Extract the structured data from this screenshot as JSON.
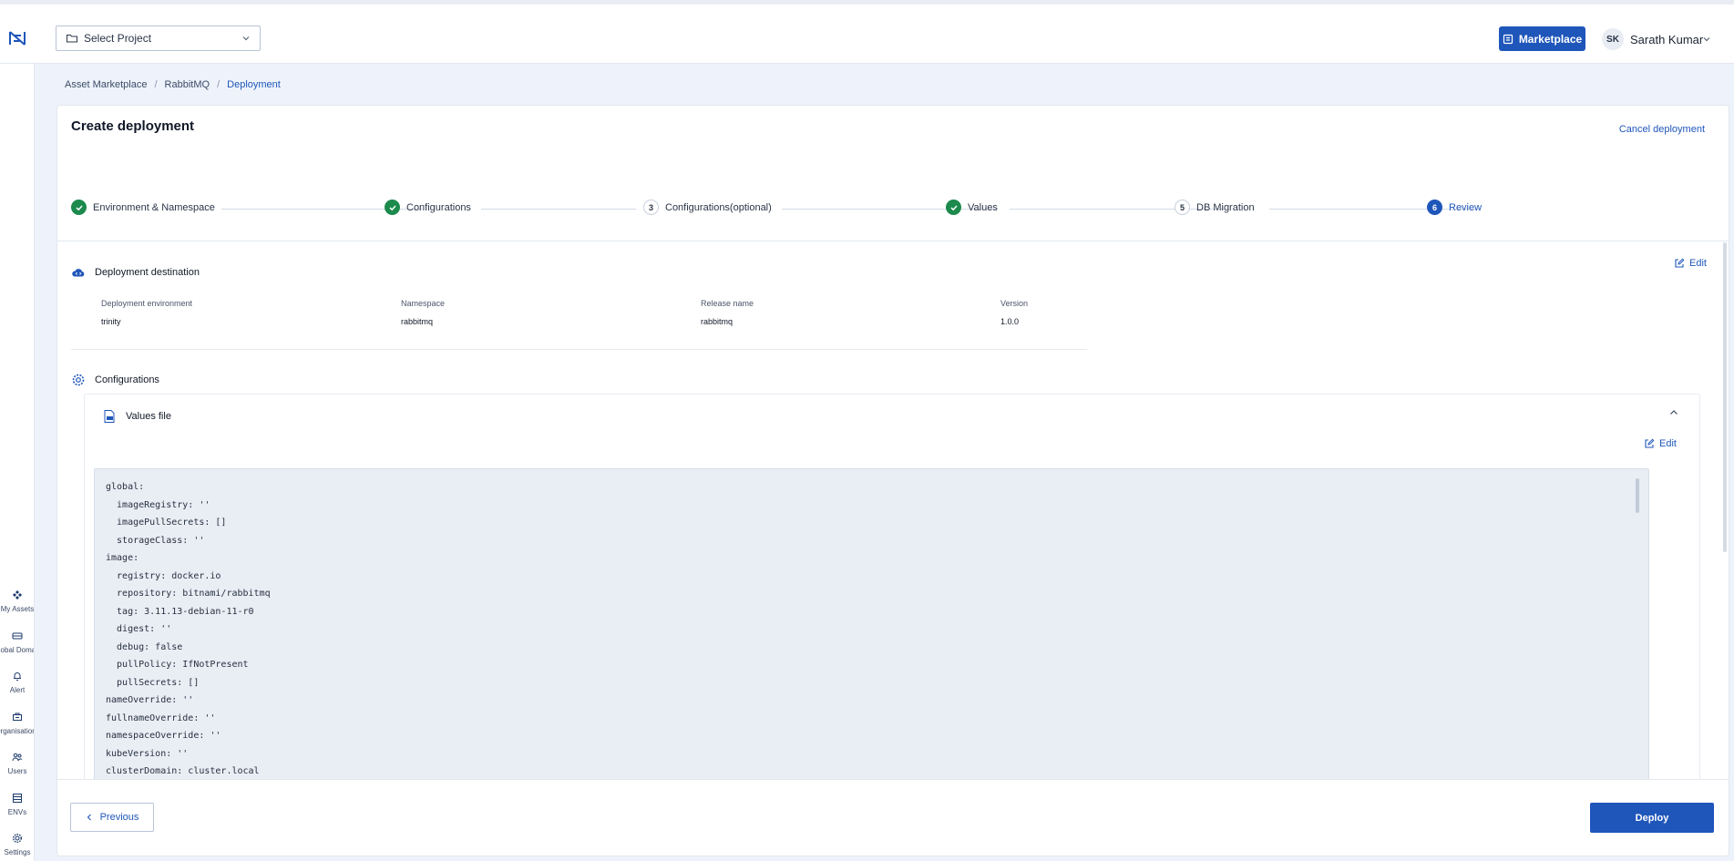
{
  "header": {
    "project_select_placeholder": "Select Project",
    "marketplace_label": "Marketplace",
    "user_initials": "SK",
    "user_name": "Sarath Kumar"
  },
  "sidebar": {
    "items": [
      {
        "label": "My Assets",
        "icon": "assets-icon"
      },
      {
        "label": "Global Domain",
        "icon": "domain-icon"
      },
      {
        "label": "Alert",
        "icon": "bell-icon"
      },
      {
        "label": "Organisations",
        "icon": "organisation-icon"
      },
      {
        "label": "Users",
        "icon": "users-icon"
      },
      {
        "label": "ENVs",
        "icon": "env-icon"
      },
      {
        "label": "Settings",
        "icon": "gear-icon"
      }
    ]
  },
  "breadcrumb": [
    "Asset Marketplace",
    "RabbitMQ",
    "Deployment"
  ],
  "page": {
    "title": "Create deployment",
    "cancel_label": "Cancel deployment"
  },
  "stepper": {
    "steps": [
      {
        "label": "Environment & Namespace",
        "status": "done",
        "number": "1"
      },
      {
        "label": "Configurations",
        "status": "done",
        "number": "2"
      },
      {
        "label": "Configurations(optional)",
        "status": "pending",
        "number": "3"
      },
      {
        "label": "Values",
        "status": "done",
        "number": "4"
      },
      {
        "label": "DB Migration",
        "status": "pending",
        "number": "5"
      },
      {
        "label": "Review",
        "status": "current",
        "number": "6"
      }
    ]
  },
  "destination": {
    "title": "Deployment destination",
    "edit_label": "Edit",
    "fields": [
      {
        "label": "Deployment environment",
        "value": "trinity"
      },
      {
        "label": "Namespace",
        "value": "rabbitmq"
      },
      {
        "label": "Release name",
        "value": "rabbitmq"
      },
      {
        "label": "Version",
        "value": "1.0.0"
      }
    ]
  },
  "configurations": {
    "title": "Configurations",
    "values_file_title": "Values file",
    "edit_label": "Edit",
    "code_lines": [
      "global:",
      "  imageRegistry: ''",
      "  imagePullSecrets: []",
      "  storageClass: ''",
      "image:",
      "  registry: docker.io",
      "  repository: bitnami/rabbitmq",
      "  tag: 3.11.13-debian-11-r0",
      "  digest: ''",
      "  debug: false",
      "  pullPolicy: IfNotPresent",
      "  pullSecrets: []",
      "nameOverride: ''",
      "fullnameOverride: ''",
      "namespaceOverride: ''",
      "kubeVersion: ''",
      "clusterDomain: cluster.local"
    ]
  },
  "footer": {
    "previous_label": "Previous",
    "deploy_label": "Deploy"
  },
  "colors": {
    "primary": "#1f56ba",
    "success": "#1b8a4c",
    "background": "#eef3fb"
  }
}
